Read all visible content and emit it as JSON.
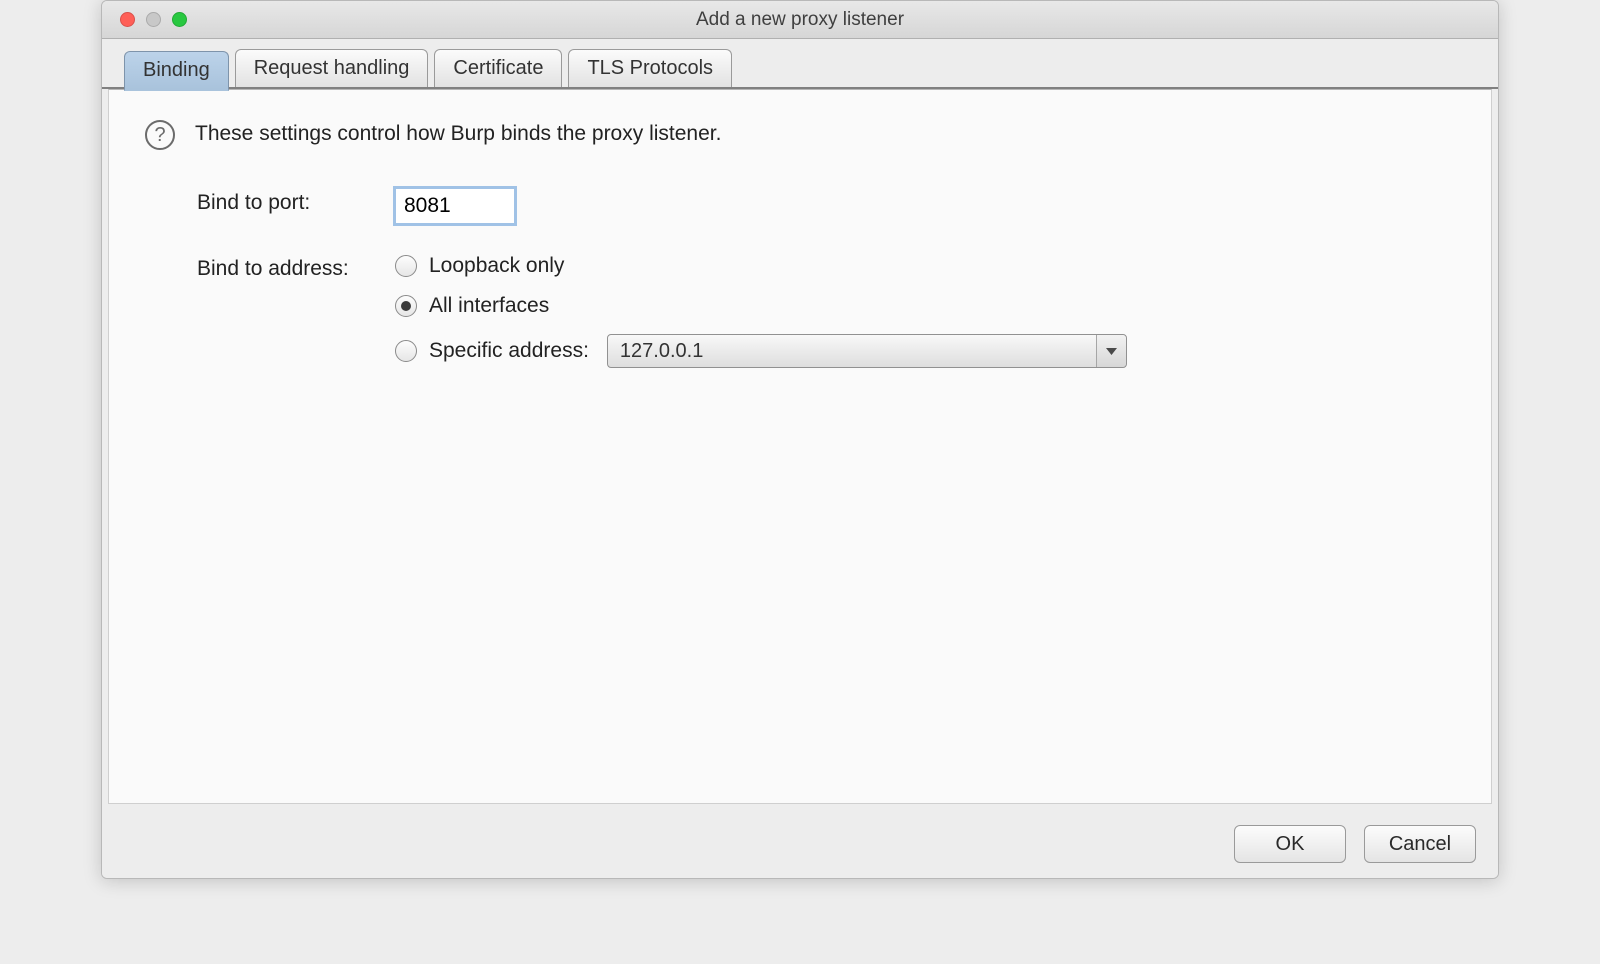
{
  "window": {
    "title": "Add a new proxy listener"
  },
  "tabs": [
    {
      "label": "Binding",
      "active": true
    },
    {
      "label": "Request handling",
      "active": false
    },
    {
      "label": "Certificate",
      "active": false
    },
    {
      "label": "TLS Protocols",
      "active": false
    }
  ],
  "help_text": "These settings control how Burp binds the proxy listener.",
  "form": {
    "port_label": "Bind to port:",
    "port_value": "8081",
    "address_label": "Bind to address:",
    "radio_loopback": "Loopback only",
    "radio_all": "All interfaces",
    "radio_specific": "Specific address:",
    "selected_address_option": "all",
    "specific_address_value": "127.0.0.1"
  },
  "buttons": {
    "ok": "OK",
    "cancel": "Cancel"
  }
}
